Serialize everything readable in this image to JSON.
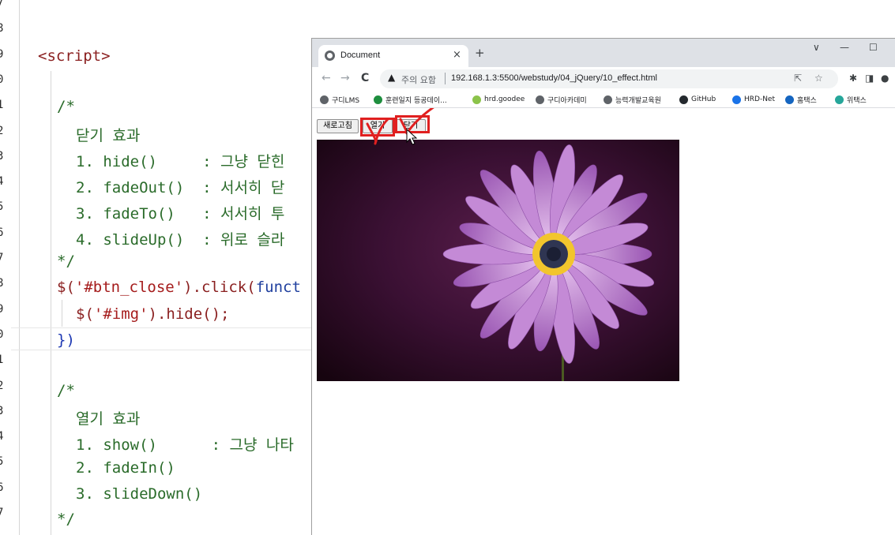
{
  "editor": {
    "line_numbers": [
      "7",
      "8",
      "9",
      "0",
      "1",
      "2",
      "3",
      "4",
      "5",
      "6",
      "7",
      "8",
      "9",
      "0",
      "1",
      "2",
      "3",
      "4",
      "5",
      "6",
      "7"
    ],
    "lines": {
      "script_tag": "<script>",
      "c1_open": "/*",
      "c1_title": "닫기 효과",
      "c1_item1": "1. hide()     : 그냥 닫힌",
      "c1_item2": "2. fadeOut()  : 서서히 닫",
      "c1_item3": "3. fadeTo()   : 서서히 투",
      "c1_item4": "4. slideUp()  : 위로 슬라",
      "c1_close": "*/",
      "click_dollar": "$(",
      "click_selector": "'#btn_close'",
      "click_rest": ").click(",
      "click_kw": "funct",
      "hide_dollar": "$(",
      "hide_selector": "'#img'",
      "hide_rest": ").hide();",
      "close_brace": "})",
      "c2_open": "/*",
      "c2_title": "열기 효과",
      "c2_item1": "1. show()      : 그냥 나타",
      "c2_item2": "2. fadeIn()",
      "c2_item3": "3. slideDown()",
      "c2_close": "*/"
    }
  },
  "browser": {
    "tab_title": "Document",
    "tab_close": "×",
    "new_tab": "+",
    "window_controls": {
      "dropdown": "∨",
      "minimize": "—",
      "maximize": "☐"
    },
    "nav": {
      "back": "←",
      "forward": "→",
      "reload": "C"
    },
    "security_warning": "주의 요함",
    "url": "192.168.1.3:5500/webstudy/04_jQuery/10_effect.html",
    "bookmarks": [
      {
        "label": "구디LMS",
        "color": "#5f6368"
      },
      {
        "label": "훈련일지 등공데이...",
        "color": "#1e8e3e"
      },
      {
        "label": "hrd.goodee",
        "color": "#8bc34a"
      },
      {
        "label": "구디아카데미",
        "color": "#5f6368"
      },
      {
        "label": "능력개발교육원",
        "color": "#5f6368"
      },
      {
        "label": "GitHub",
        "color": "#24292e"
      },
      {
        "label": "HRD-Net",
        "color": "#1a73e8"
      },
      {
        "label": "홈택스",
        "color": "#1565c0"
      },
      {
        "label": "위택스",
        "color": "#26a69a"
      }
    ],
    "page": {
      "refresh_button": "새로고침",
      "open_button": "열기",
      "close_button": "닫기"
    }
  },
  "colors": {
    "annotation_red": "#e02020",
    "flower_petal": "#c48ad6",
    "flower_background": "#2b0b24"
  }
}
